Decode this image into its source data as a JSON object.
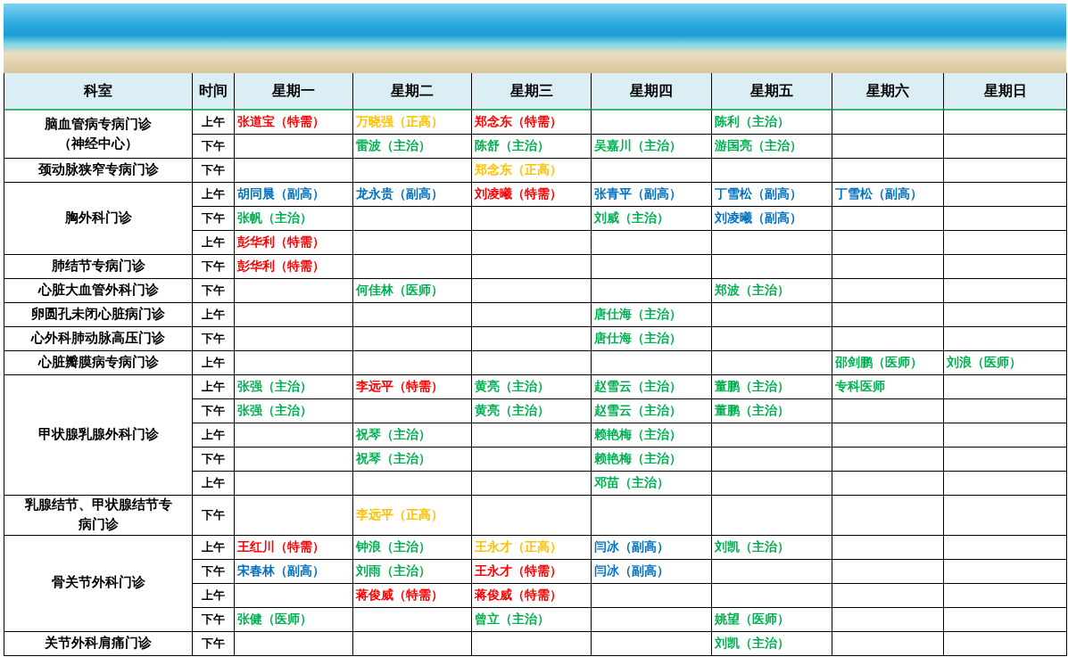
{
  "table": {
    "columns": [
      "科室",
      "时间",
      "星期一",
      "星期二",
      "星期三",
      "星期四",
      "星期五",
      "星期六",
      "星期日"
    ],
    "departments": [
      {
        "name_lines": [
          "脑血管病专病门诊",
          "（神经中心）"
        ],
        "sessions": [
          {
            "time": "上午",
            "slots": {
              "mon": {
                "doctor": "张道宝（特需）",
                "color": "#ff0000"
              },
              "tue": {
                "doctor": "万晓强（正高）",
                "color": "#ffc000"
              },
              "wed": {
                "doctor": "郑念东（特需）",
                "color": "#ff0000"
              },
              "fri": {
                "doctor": "陈利（主治）",
                "color": "#00b050"
              }
            }
          },
          {
            "time": "下午",
            "slots": {
              "tue": {
                "doctor": "雷波（主治）",
                "color": "#00b050"
              },
              "wed": {
                "doctor": "陈舒（主治）",
                "color": "#00b050"
              },
              "thu": {
                "doctor": "吴嘉川（主治）",
                "color": "#00b050"
              },
              "fri": {
                "doctor": "游国亮（主治）",
                "color": "#00b050"
              }
            }
          }
        ]
      },
      {
        "name_lines": [
          "颈动脉狭窄专病门诊"
        ],
        "sessions": [
          {
            "time": "下午",
            "slots": {
              "wed": {
                "doctor": "郑念东（正高）",
                "color": "#ffc000"
              }
            }
          }
        ]
      },
      {
        "name_lines": [
          "胸外科门诊"
        ],
        "sessions": [
          {
            "time": "上午",
            "slots": {
              "mon": {
                "doctor": "胡同晨（副高）",
                "color": "#0070c0"
              },
              "tue": {
                "doctor": "龙永贵（副高）",
                "color": "#0070c0"
              },
              "wed": {
                "doctor": "刘凌曦（特需）",
                "color": "#ff0000"
              },
              "thu": {
                "doctor": "张青平（副高）",
                "color": "#0070c0"
              },
              "fri": {
                "doctor": "丁雪松（副高）",
                "color": "#0070c0"
              },
              "sat": {
                "doctor": "丁雪松（副高）",
                "color": "#0070c0"
              }
            }
          },
          {
            "time": "下午",
            "slots": {
              "mon": {
                "doctor": "张帆（主治）",
                "color": "#00b050"
              },
              "thu": {
                "doctor": "刘威（主治）",
                "color": "#00b050"
              },
              "fri": {
                "doctor": "刘凌曦（副高）",
                "color": "#0070c0"
              }
            }
          },
          {
            "time": "上午",
            "slots": {
              "mon": {
                "doctor": "彭华利（特需）",
                "color": "#ff0000"
              }
            }
          }
        ]
      },
      {
        "name_lines": [
          "肺结节专病门诊"
        ],
        "sessions": [
          {
            "time": "下午",
            "slots": {
              "mon": {
                "doctor": "彭华利（特需）",
                "color": "#ff0000"
              }
            }
          }
        ]
      },
      {
        "name_lines": [
          "心脏大血管外科门诊"
        ],
        "sessions": [
          {
            "time": "下午",
            "slots": {
              "tue": {
                "doctor": "何佳林（医师）",
                "color": "#00b050"
              },
              "fri": {
                "doctor": "郑波（主治）",
                "color": "#00b050"
              }
            }
          }
        ]
      },
      {
        "name_lines": [
          "卵圆孔未闭心脏病门诊"
        ],
        "sessions": [
          {
            "time": "上午",
            "slots": {
              "thu": {
                "doctor": "唐仕海（主治）",
                "color": "#00b050"
              }
            }
          }
        ]
      },
      {
        "name_lines": [
          "心外科肺动脉高压门诊"
        ],
        "sessions": [
          {
            "time": "下午",
            "slots": {
              "thu": {
                "doctor": "唐仕海（主治）",
                "color": "#00b050"
              }
            }
          }
        ]
      },
      {
        "name_lines": [
          "心脏瓣膜病专病门诊"
        ],
        "sessions": [
          {
            "time": "上午",
            "slots": {
              "sat": {
                "doctor": "邵剑鹏（医师）",
                "color": "#00b050"
              },
              "sun": {
                "doctor": "刘浪（医师）",
                "color": "#00b050"
              }
            }
          }
        ]
      },
      {
        "name_lines": [
          "甲状腺乳腺外科门诊"
        ],
        "sessions": [
          {
            "time": "上午",
            "slots": {
              "mon": {
                "doctor": "张强（主治）",
                "color": "#00b050"
              },
              "tue": {
                "doctor": "李远平（特需）",
                "color": "#ff0000"
              },
              "wed": {
                "doctor": "黄亮（主治）",
                "color": "#00b050"
              },
              "thu": {
                "doctor": "赵雪云（主治）",
                "color": "#00b050"
              },
              "fri": {
                "doctor": "董鹏（主治）",
                "color": "#00b050"
              },
              "sat": {
                "doctor": "专科医师",
                "color": "#00b050"
              }
            }
          },
          {
            "time": "下午",
            "slots": {
              "mon": {
                "doctor": "张强（主治）",
                "color": "#00b050"
              },
              "wed": {
                "doctor": "黄亮（主治）",
                "color": "#00b050"
              },
              "thu": {
                "doctor": "赵雪云（主治）",
                "color": "#00b050"
              },
              "fri": {
                "doctor": "董鹏（主治）",
                "color": "#00b050"
              }
            }
          },
          {
            "time": "上午",
            "slots": {
              "tue": {
                "doctor": "祝琴（主治）",
                "color": "#00b050"
              },
              "thu": {
                "doctor": "赖艳梅（主治）",
                "color": "#00b050"
              }
            }
          },
          {
            "time": "下午",
            "slots": {
              "tue": {
                "doctor": "祝琴（主治）",
                "color": "#00b050"
              },
              "thu": {
                "doctor": "赖艳梅（主治）",
                "color": "#00b050"
              }
            }
          },
          {
            "time": "上午",
            "slots": {
              "thu": {
                "doctor": "邓苗（主治）",
                "color": "#00b050"
              }
            }
          }
        ]
      },
      {
        "name_lines": [
          "乳腺结节、甲状腺结节专",
          "病门诊"
        ],
        "sessions": [
          {
            "time": "下午",
            "slots": {
              "tue": {
                "doctor": "李远平（正高）",
                "color": "#ffc000"
              }
            }
          }
        ]
      },
      {
        "name_lines": [
          "骨关节外科门诊"
        ],
        "sessions": [
          {
            "time": "上午",
            "slots": {
              "mon": {
                "doctor": "王红川（特需）",
                "color": "#ff0000"
              },
              "tue": {
                "doctor": "钟浪（主治）",
                "color": "#00b050"
              },
              "wed": {
                "doctor": "王永才（正高）",
                "color": "#ffc000"
              },
              "thu": {
                "doctor": "闫冰（副高）",
                "color": "#0070c0"
              },
              "fri": {
                "doctor": "刘凯（主治）",
                "color": "#00b050"
              }
            }
          },
          {
            "time": "下午",
            "slots": {
              "mon": {
                "doctor": "宋春林（副高）",
                "color": "#0070c0"
              },
              "tue": {
                "doctor": "刘雨（主治）",
                "color": "#00b050"
              },
              "wed": {
                "doctor": "王永才（特需）",
                "color": "#ff0000"
              },
              "thu": {
                "doctor": "闫冰（副高）",
                "color": "#0070c0"
              }
            }
          },
          {
            "time": "上午",
            "slots": {
              "tue": {
                "doctor": "蒋俊威（特需）",
                "color": "#ff0000"
              },
              "wed": {
                "doctor": "蒋俊威（特需）",
                "color": "#ff0000"
              }
            }
          },
          {
            "time": "下午",
            "slots": {
              "mon": {
                "doctor": "张健（医师）",
                "color": "#00b050"
              },
              "wed": {
                "doctor": "曾立（主治）",
                "color": "#00b050"
              },
              "fri": {
                "doctor": "姚望（医师）",
                "color": "#00b050"
              }
            }
          }
        ]
      },
      {
        "name_lines": [
          "关节外科肩痛门诊"
        ],
        "sessions": [
          {
            "time": "下午",
            "slots": {
              "fri": {
                "doctor": "刘凯（主治）",
                "color": "#00b050"
              }
            }
          }
        ]
      }
    ]
  }
}
